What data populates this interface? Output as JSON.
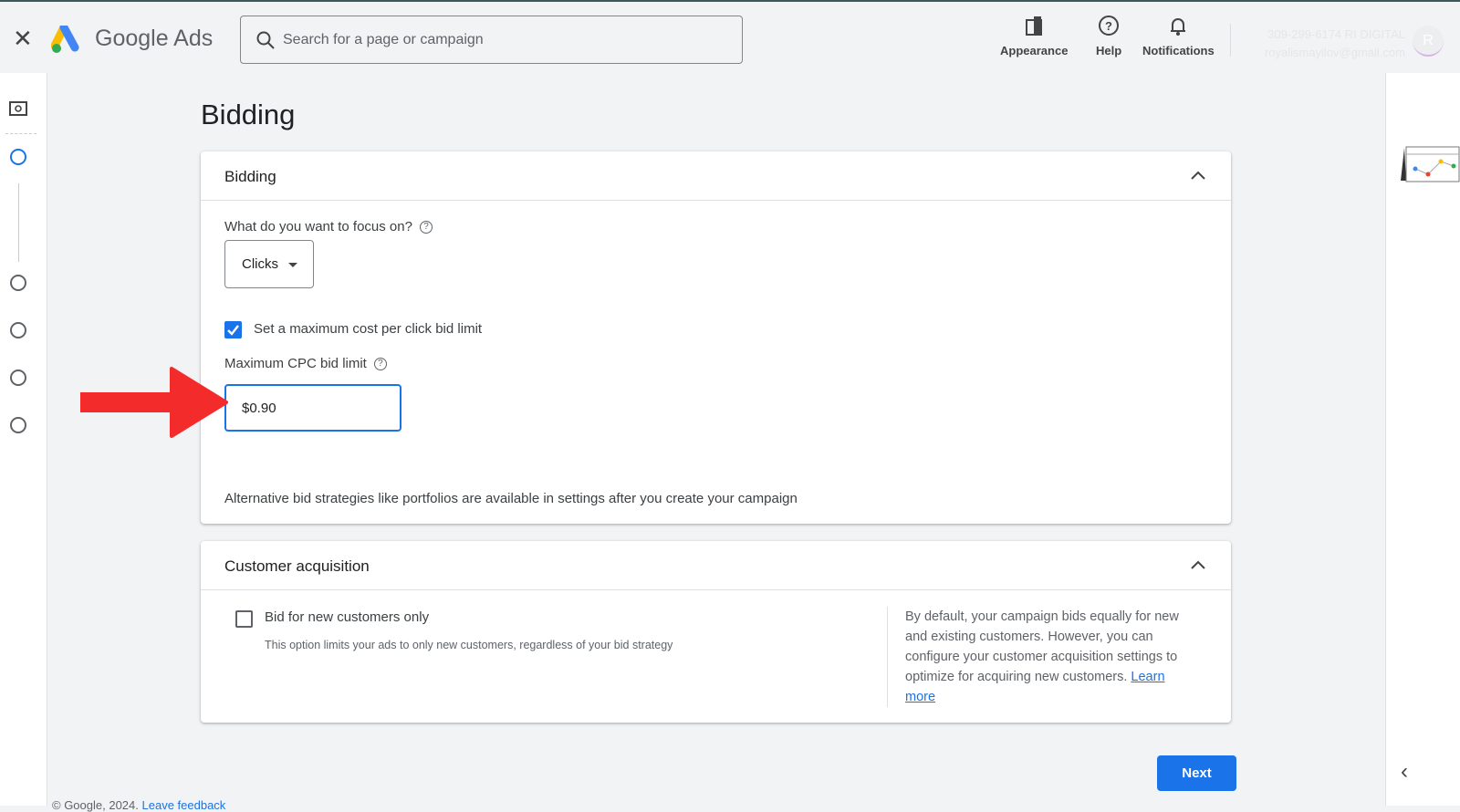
{
  "header": {
    "brand": "Google Ads",
    "search_placeholder": "Search for a page or campaign",
    "appearance": "Appearance",
    "help": "Help",
    "notifications": "Notifications",
    "account_line1": "309-299-6174 RI DIGITAL",
    "account_line2": "royalismayilov@gmail.com",
    "avatar_initial": "R"
  },
  "page": {
    "title": "Bidding"
  },
  "bidding": {
    "title": "Bidding",
    "focus_label": "What do you want to focus on?",
    "focus_value": "Clicks",
    "max_cpc_checkbox": "Set a maximum cost per click bid limit",
    "max_cpc_checked": true,
    "max_cpc_label": "Maximum CPC bid limit",
    "currency": "$",
    "max_cpc_value": "0.90",
    "note": "Alternative bid strategies like portfolios are available in settings after you create your campaign"
  },
  "customer": {
    "title": "Customer acquisition",
    "checkbox": "Bid for new customers only",
    "checked": false,
    "hint": "This option limits your ads to only new customers, regardless of your bid strategy",
    "desc": "By default, your campaign bids equally for new and existing customers. However, you can configure your customer acquisition settings to optimize for acquiring new customers.",
    "learn_more": "Learn more"
  },
  "actions": {
    "next": "Next"
  },
  "footer": {
    "copyright": "© Google, 2024.",
    "feedback": "Leave feedback"
  },
  "colors": {
    "accent": "#1a73e8",
    "annotation_arrow": "#f42b2b"
  }
}
